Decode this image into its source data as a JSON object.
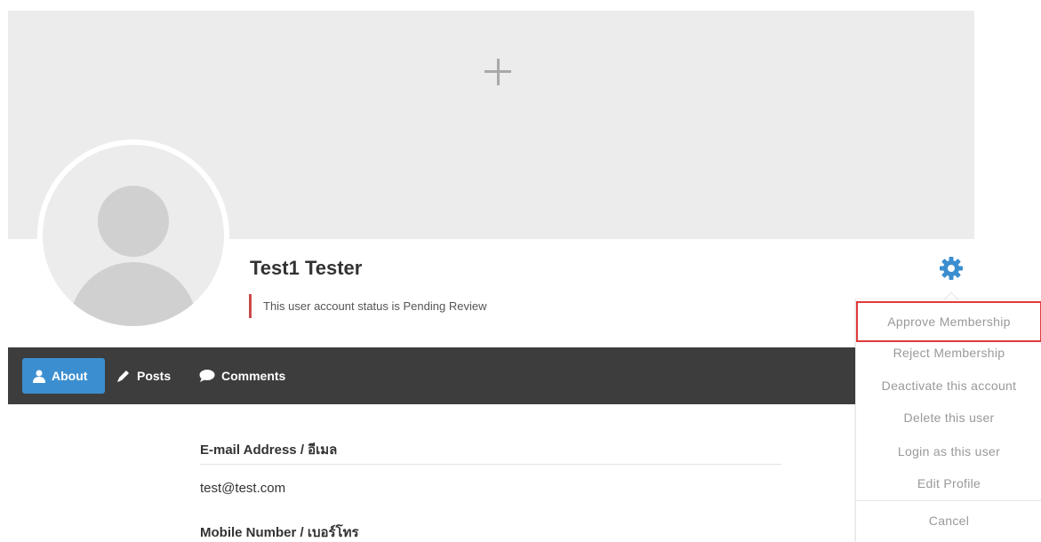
{
  "profile": {
    "name": "Test1 Tester",
    "status_message": "This user account status is Pending Review"
  },
  "icons": {
    "cover_add": "plus-icon",
    "avatar": "user-placeholder-icon",
    "settings": "gear-icon",
    "about": "user-icon",
    "posts": "pencil-icon",
    "comments": "comment-bubble-icon"
  },
  "colors": {
    "accent": "#3b8fd0",
    "nav_bg": "#3d3d3d",
    "status_bar": "#c94a4a",
    "highlight_box": "#e03b3b"
  },
  "tabs": [
    {
      "label": "About",
      "active": true
    },
    {
      "label": "Posts",
      "active": false
    },
    {
      "label": "Comments",
      "active": false
    }
  ],
  "fields": [
    {
      "label": "E-mail Address / อีเมล",
      "value": "test@test.com"
    },
    {
      "label": "Mobile Number / เบอร์โทร",
      "value": ""
    }
  ],
  "actions_menu": {
    "items": [
      "Approve Membership",
      "Reject Membership",
      "Deactivate this account",
      "Delete this user",
      "Login as this user",
      "Edit Profile"
    ],
    "cancel": "Cancel",
    "highlighted": "Approve Membership"
  }
}
